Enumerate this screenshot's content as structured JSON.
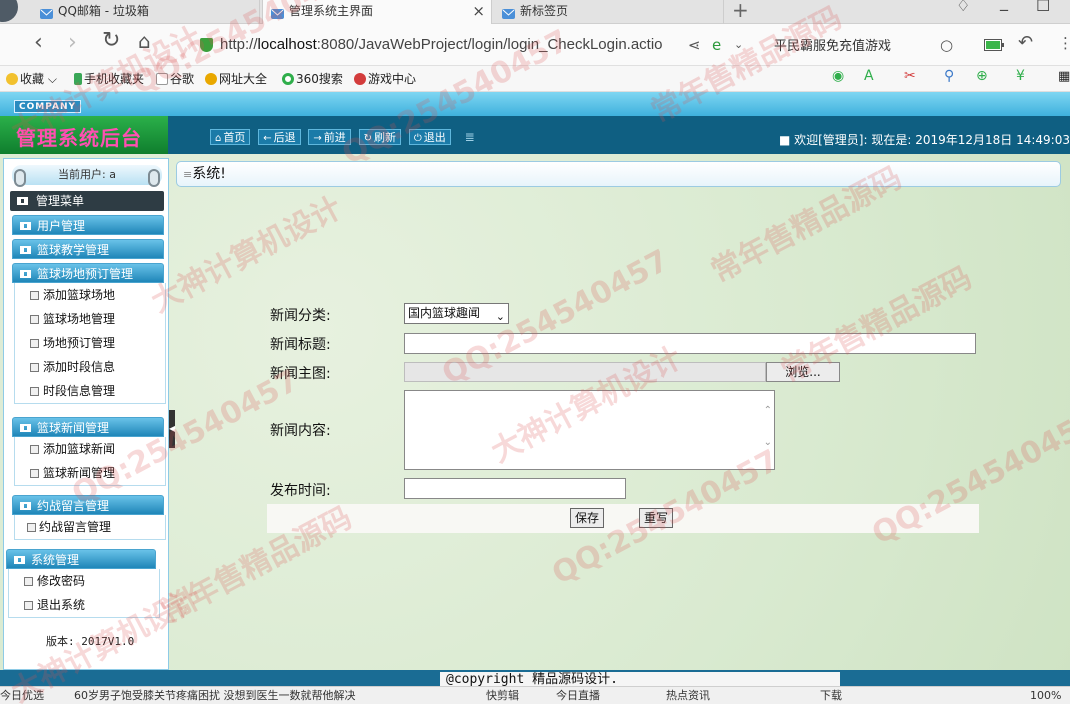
{
  "browser": {
    "tabs": [
      {
        "label": "QQ邮箱 - 垃圾箱"
      },
      {
        "label": "管理系统主界面"
      },
      {
        "label": "新标签页"
      }
    ],
    "url_prefix": "http://",
    "url_host": "localhost",
    "url_rest": ":8080/JavaWebProject/login/login_CheckLogin.actio",
    "search_suggest": "平民霸服免充值游戏",
    "favorites": [
      {
        "label": "收藏",
        "color": "#f2c12e"
      },
      {
        "label": "手机收藏夹",
        "color": "#3aa757"
      },
      {
        "label": "谷歌",
        "color": "#bbbbbb"
      },
      {
        "label": "网址大全",
        "color": "#e9a800"
      },
      {
        "label": "360搜索",
        "color": "#2fae4b"
      },
      {
        "label": "游戏中心",
        "color": "#d33c3c"
      }
    ]
  },
  "header": {
    "company": "COMPANY",
    "title": "管理系统后台",
    "nav": [
      {
        "icon": "⌂",
        "label": "首页"
      },
      {
        "icon": "←",
        "label": "后退"
      },
      {
        "icon": "→",
        "label": "前进"
      },
      {
        "icon": "↻",
        "label": "刷新"
      },
      {
        "icon": "⏻",
        "label": "退出"
      }
    ],
    "welcome": "■ 欢迎[管理员]:  现在是: 2019年12月18日 14:49:03"
  },
  "sidebar": {
    "current_user": "当前用户: a",
    "menu_title": "管理菜单",
    "groups": [
      {
        "label": "用户管理",
        "items": []
      },
      {
        "label": "篮球教学管理",
        "items": []
      },
      {
        "label": "篮球场地预订管理",
        "items": [
          "添加篮球场地",
          "篮球场地管理",
          "场地预订管理",
          "添加时段信息",
          "时段信息管理"
        ]
      },
      {
        "label": "篮球新闻管理",
        "items": [
          "添加篮球新闻",
          "篮球新闻管理"
        ]
      },
      {
        "label": "约战留言管理",
        "items": [
          "约战留言管理"
        ]
      },
      {
        "label": "系统管理",
        "items": [
          "修改密码",
          "退出系统"
        ]
      }
    ],
    "version": "版本: 2017V1.0"
  },
  "breadcrumb": "系统!",
  "form": {
    "category_label": "新闻分类:",
    "category_value": "国内篮球趣闻",
    "title_label": "新闻标题:",
    "image_label": "新闻主图:",
    "browse_label": "浏览...",
    "content_label": "新闻内容:",
    "time_label": "发布时间:",
    "save_label": "保存",
    "reset_label": "重写"
  },
  "footer": {
    "copyright": "@copyright 精品源码设计."
  },
  "statusbar": {
    "items": [
      "今日优选",
      "60岁男子饱受膝关节疼痛困扰 没想到医生一数就帮他解决",
      "快剪辑",
      "今日直播",
      "热点资讯",
      "下载",
      "100%"
    ]
  },
  "watermarks": [
    "QQ:254540457",
    "大神计算机设计",
    "常年售精品源码",
    "QQ:254540457",
    "大神计算机设计",
    "常年售精品源码",
    "QQ:254540457",
    "常年售精品源码",
    "大神计算机设计",
    "QQ:254540457",
    "常年售精品源码",
    "QQ:254540457",
    "大神计算机设计",
    "QQ:254540457"
  ]
}
